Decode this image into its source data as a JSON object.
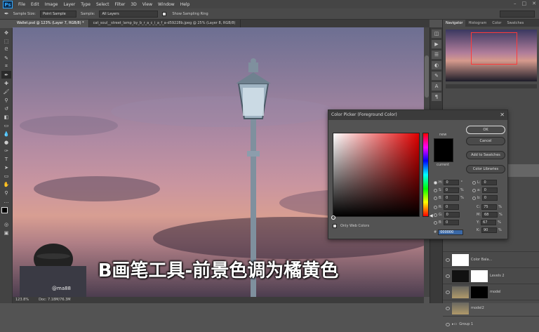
{
  "menubar": {
    "logo": "Ps",
    "items": [
      "File",
      "Edit",
      "Image",
      "Layer",
      "Type",
      "Select",
      "Filter",
      "3D",
      "View",
      "Window",
      "Help"
    ],
    "controls": [
      "–",
      "□",
      "✕"
    ]
  },
  "options": {
    "sample_size_label": "Sample Size:",
    "sample_size_value": "Point Sample",
    "sample_label": "Sample:",
    "sample_value": "All Layers",
    "sampling_ring_label": "Show Sampling Ring"
  },
  "tabs": [
    {
      "label": "Wallet.psd @ 123% (Layer 7, RGB/8) *"
    },
    {
      "label": "cat_soul__street_lamp_by_b_r_a_c_i_a_f_a-d59228b.jpeg @ 25% (Layer 8, RGB/8)"
    }
  ],
  "status": {
    "zoom": "123.8%",
    "doc": "Doc: 7.18M/76.3M"
  },
  "panel_tabs": [
    "Navigator",
    "Histogram",
    "Color",
    "Swatches"
  ],
  "dialog": {
    "title": "Color Picker (Foreground Color)",
    "new_label": "new",
    "current_label": "current",
    "buttons": {
      "ok": "OK",
      "cancel": "Cancel",
      "add_to_swatches": "Add to Swatches",
      "color_libraries": "Color Libraries"
    },
    "web_colors": "Only Web Colors",
    "hsb": [
      {
        "k": "H:",
        "v": "0",
        "u": "°"
      },
      {
        "k": "S:",
        "v": "0",
        "u": "%"
      },
      {
        "k": "B:",
        "v": "0",
        "u": "%"
      }
    ],
    "rgb": [
      {
        "k": "R:",
        "v": "0"
      },
      {
        "k": "G:",
        "v": "0"
      },
      {
        "k": "B:",
        "v": "0"
      }
    ],
    "lab": [
      {
        "k": "L:",
        "v": "0"
      },
      {
        "k": "a:",
        "v": "0"
      },
      {
        "k": "b:",
        "v": "0"
      }
    ],
    "cmyk": [
      {
        "k": "C:",
        "v": "75",
        "u": "%"
      },
      {
        "k": "M:",
        "v": "68",
        "u": "%"
      },
      {
        "k": "Y:",
        "v": "67",
        "u": "%"
      },
      {
        "k": "K:",
        "v": "90",
        "u": "%"
      }
    ],
    "hex_label": "#",
    "hex": "000000"
  },
  "layers": [
    {
      "name": "Color Bala..."
    },
    {
      "name": "Levels 2"
    },
    {
      "name": "model"
    },
    {
      "name": "model2"
    },
    {
      "name": "Group 1"
    }
  ],
  "subtitle": "B画笔工具-前景色调为橘黄色",
  "watermark": "@ma88"
}
